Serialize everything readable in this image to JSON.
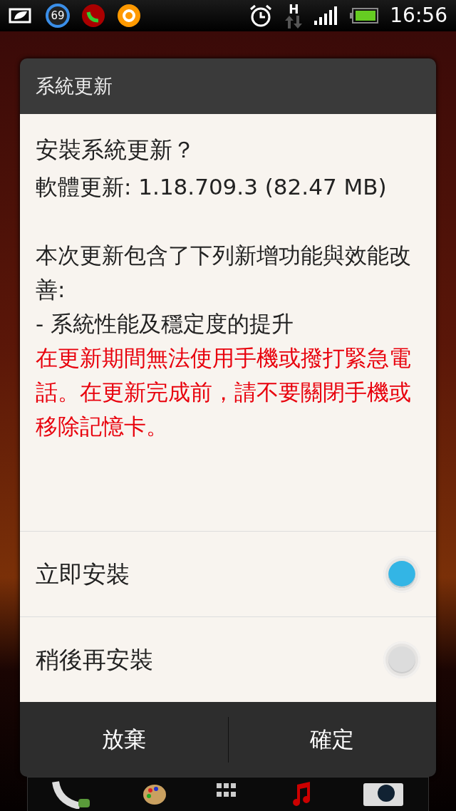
{
  "status_bar": {
    "notification_badge": "69",
    "network_type": "H",
    "time": "16:56"
  },
  "dialog": {
    "title": "系統更新",
    "heading": "安裝系統更新？",
    "version_line": "軟體更新: 1.18.709.3 (82.47 MB)",
    "description": [
      "本次更新包含了下列新增功能與效能改善:",
      "- 系統性能及穩定度的提升"
    ],
    "warning": "在更新期間無法使用手機或撥打緊急電話。在更新完成前，請不要關閉手機或移除記憶卡。",
    "options": [
      {
        "label": "立即安裝",
        "selected": true
      },
      {
        "label": "稍後再安裝",
        "selected": false
      }
    ],
    "buttons": [
      "放棄",
      "確定"
    ]
  }
}
